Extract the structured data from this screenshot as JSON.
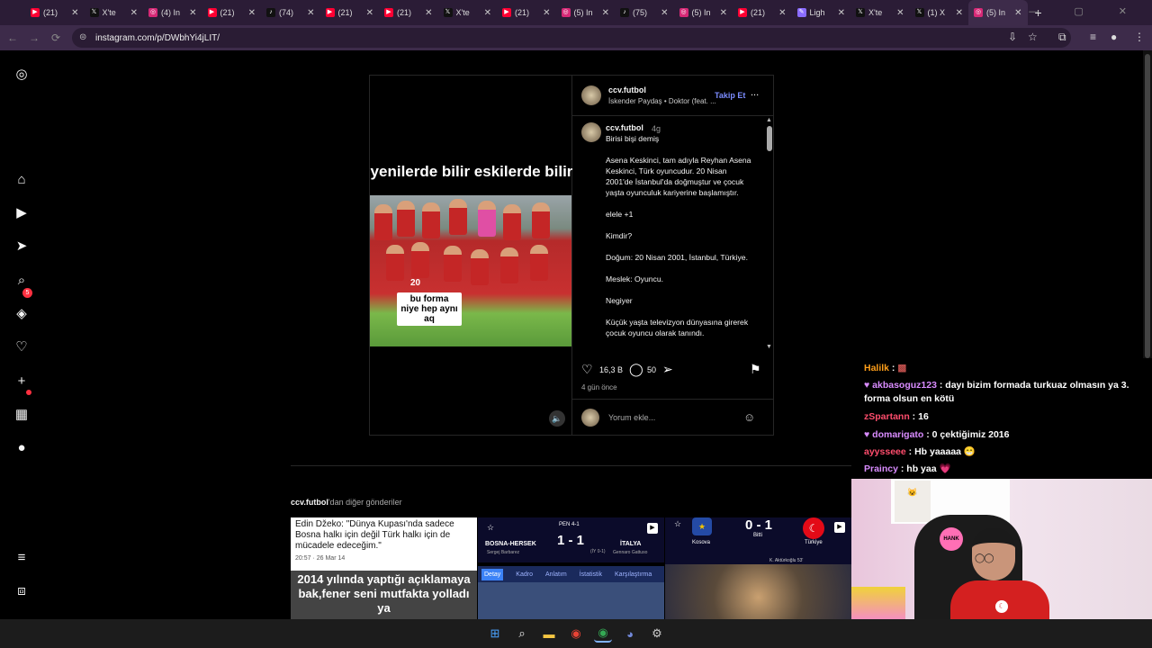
{
  "browser": {
    "tabs": [
      {
        "label": "(21)",
        "kind": "youtube"
      },
      {
        "label": "X'te",
        "kind": "x"
      },
      {
        "label": "(4) In",
        "kind": "instagram"
      },
      {
        "label": "(21)",
        "kind": "youtube"
      },
      {
        "label": "(74)",
        "kind": "tiktok"
      },
      {
        "label": "(21)",
        "kind": "youtube"
      },
      {
        "label": "(21)",
        "kind": "youtube"
      },
      {
        "label": "X'te",
        "kind": "x"
      },
      {
        "label": "(21)",
        "kind": "youtube"
      },
      {
        "label": "(5) In",
        "kind": "instagram"
      },
      {
        "label": "(75)",
        "kind": "tiktok"
      },
      {
        "label": "(5) In",
        "kind": "instagram"
      },
      {
        "label": "(21)",
        "kind": "youtube"
      },
      {
        "label": "Ligh",
        "kind": "feather"
      },
      {
        "label": "X'te",
        "kind": "x"
      },
      {
        "label": "(1) X",
        "kind": "x"
      },
      {
        "label": "(5) In",
        "kind": "instagram",
        "active": true
      }
    ],
    "url": "instagram.com/p/DWbhYi4jLIT/"
  },
  "post": {
    "username": "ccv.futbol",
    "song": "İskender Paydaş • Doktor (feat. ...",
    "follow_label": "Takip Et",
    "more_label": "...",
    "video_caption_top": "yenilerde bilir eskilerde bilir",
    "video_sticker": "bu forma niye hep aynı aq",
    "jersey_number": "20",
    "caption_time": "4g",
    "caption_lines": [
      "Birisi bişi demiş",
      "Asena Keskinci, tam adıyla Reyhan Asena Keskinci, Türk oyuncudur. 20 Nisan 2001'de İstanbul'da doğmuştur ve çocuk yaşta oyunculuk kariyerine başlamıştır.",
      "elele +1",
      "Kimdir?",
      "Doğum: 20 Nisan 2001, İstanbul, Türkiye.",
      "Meslek: Oyuncu.",
      "Negiyer",
      "Küçük yaşta televizyon dünyasına girerek çocuk oyuncu olarak tanındı."
    ],
    "likes": "16,3 B",
    "comments": "50",
    "posted_ago": "4 gün önce",
    "comment_placeholder": "Yorum ekle..."
  },
  "more_posts": {
    "user": "ccv.futbol",
    "label": "'dan diğer gönderiler",
    "thumbs": [
      {
        "quote": "Edin Džeko: \"Dünya Kupası'nda sadece Bosna halkı için değil Türk halkı için de mücadele edeceğim.\"",
        "date": "20:57 · 26 Mar 14",
        "caption": "2014 yılında yaptığı açıklamaya bak,fener seni mutfakta yolladı ya"
      },
      {
        "team_a": "BOSNA-HERSEK",
        "team_b": "İTALYA",
        "score": "1 - 1",
        "pen": "PEN 4-1",
        "coach_a": "Sergej Barbarez",
        "coach_b": "Gennaro Gattuso",
        "half": "(İY 0-1)",
        "tabs": [
          "Detay",
          "Kadro",
          "Anlatım",
          "İstatistik",
          "Karşılaştırma"
        ]
      },
      {
        "team_a": "Kosova",
        "team_b": "Türkiye",
        "score": "0 - 1",
        "status": "Bitti",
        "scorer": "K. Aktürkoğlu 53'"
      }
    ]
  },
  "chat": [
    {
      "user": "Halilk",
      "text": "",
      "color": "#ff9f1a",
      "badge": "emote"
    },
    {
      "user": "akbasoguz123",
      "text": "dayı bizim formada turkuaz olmasın ya 3. forma olsun en kötü",
      "color": "#d98cff",
      "badge": "heart"
    },
    {
      "user": "zSpartann",
      "text": "16",
      "color": "#ff4d6d"
    },
    {
      "user": "domarigato",
      "text": "0 çektiğimiz 2016",
      "color": "#d98cff",
      "badge": "heart"
    },
    {
      "user": "ayysseee",
      "text": "Hb yaaaaa 😁",
      "color": "#ff4d6d"
    },
    {
      "user": "Praincy",
      "text": "hb yaa 💗",
      "color": "#d98cff"
    }
  ],
  "stream": {
    "sticker": "HANK",
    "cat_caption": "😺"
  },
  "colors": {
    "accent": "#7b8cff",
    "chrome": "#3d2b4a",
    "notif": "#ff3040"
  }
}
